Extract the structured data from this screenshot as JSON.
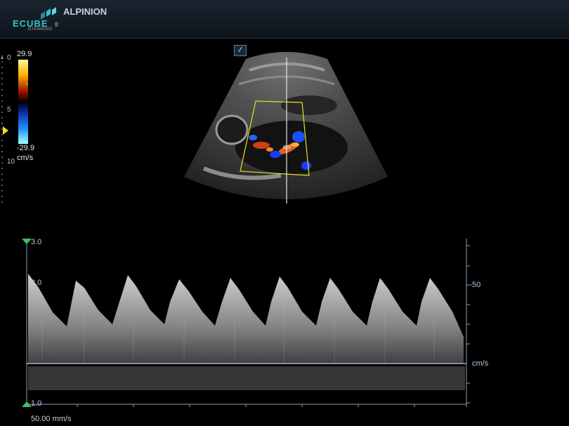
{
  "header": {
    "logo_text": "ECUBE",
    "logo_suffix": "8",
    "logo_sub": "DIAMOND",
    "brand": "ALPINION",
    "accent": "#36c2c2"
  },
  "depth_scale": {
    "labels": [
      "0",
      "5",
      "10"
    ]
  },
  "color_bar": {
    "max": "29.9",
    "min": "-29.9",
    "unit": "cm/s"
  },
  "probe_badge": {
    "icon": "probe-orientation-icon",
    "glyph": "⁄"
  },
  "doppler": {
    "left_ticks": [
      "3.0",
      "2.0",
      "1.0"
    ],
    "right_label": "50",
    "unit": "cm/s",
    "sweep_speed": "50.00 mm/s"
  }
}
